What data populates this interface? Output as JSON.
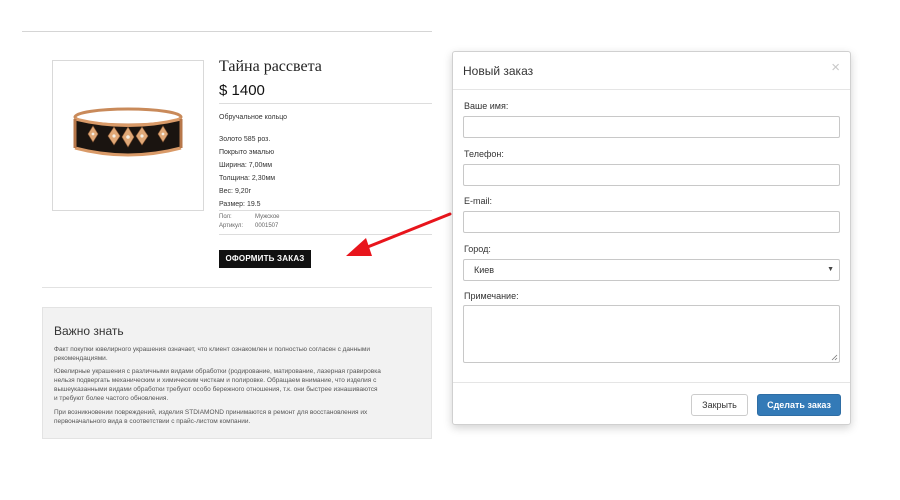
{
  "product": {
    "title": "Тайна рассвета",
    "price": "$ 1400",
    "type": "Обручальное кольцо",
    "specs": [
      "Золото 585 роз.",
      "Покрыто эмалью",
      "Ширина: 7,00мм",
      "Толщина: 2,30мм",
      "Вес: 9,20г",
      "Размер: 19.5"
    ],
    "meta": [
      {
        "key": "Пол:",
        "value": "Мужское"
      },
      {
        "key": "Артикул:",
        "value": "0001507"
      }
    ],
    "order_button": "ОФОРМИТЬ ЗАКАЗ"
  },
  "notice": {
    "title": "Важно знать",
    "paragraphs": [
      [
        "Факт покупки ювелирного украшения означает, что клиент ознакомлен и полностью согласен с данными",
        "рекомендациями."
      ],
      [
        "Ювелирные украшения с различными видами обработки (родирование, матирование, лазерная гравировка",
        "нельзя подвергать механическим и химическим чисткам и полировке. Обращаем внимание, что изделия с",
        "вышеуказанными видами обработки требуют особо бережного отношения, т.к. они быстрее изнашиваются",
        "и требуют более частого обновления."
      ],
      [
        "При возникновении повреждений, изделия STDIAMOND принимаются в ремонт для восстановления их",
        "первоначального вида в соответствии с прайс-листом компании."
      ]
    ]
  },
  "modal": {
    "title": "Новый заказ",
    "close_glyph": "×",
    "name_label": "Ваше имя:",
    "phone_label": "Телефон:",
    "email_label": "E-mail:",
    "city_label": "Город:",
    "city_value": "Киев",
    "note_label": "Примечание:",
    "close_button": "Закрыть",
    "submit_button": "Сделать заказ"
  },
  "colors": {
    "primary_button": "#337ab7",
    "arrow": "#e8151c",
    "order_button": "#111111"
  },
  "icons": [
    "ring-image",
    "close-icon",
    "chevron-down-icon",
    "resize-handle-icon",
    "red-arrow-icon"
  ]
}
